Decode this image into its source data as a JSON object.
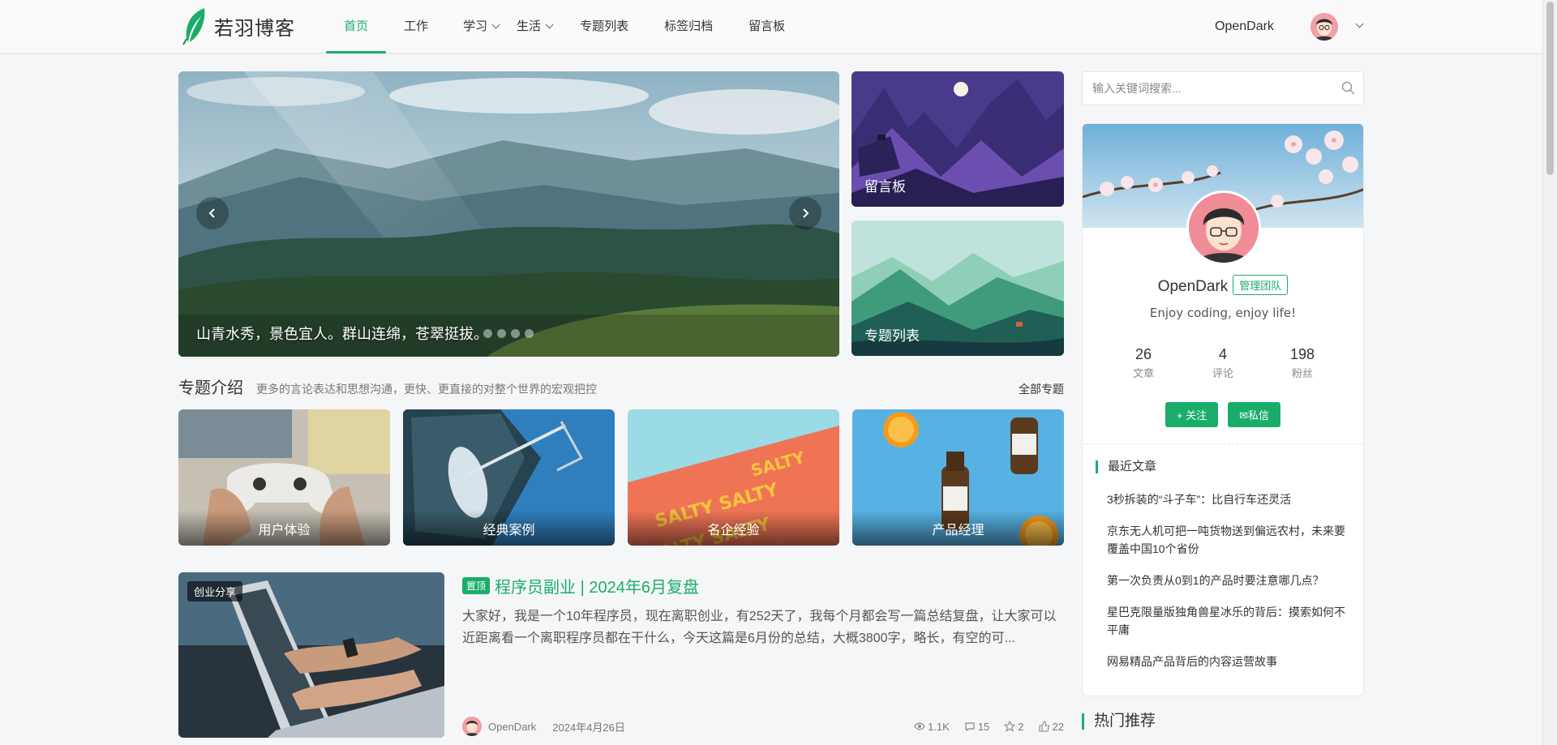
{
  "header": {
    "logo_text": "若羽博客",
    "nav": [
      {
        "label": "首页",
        "active": true,
        "has_dropdown": false
      },
      {
        "label": "工作",
        "active": false,
        "has_dropdown": false
      },
      {
        "label": "学习",
        "active": false,
        "has_dropdown": true
      },
      {
        "label": "生活",
        "active": false,
        "has_dropdown": true
      },
      {
        "label": "专题列表",
        "active": false,
        "has_dropdown": false
      },
      {
        "label": "标签归档",
        "active": false,
        "has_dropdown": false
      },
      {
        "label": "留言板",
        "active": false,
        "has_dropdown": false
      }
    ],
    "user_name": "OpenDark",
    "accent_color": "#1aad6a"
  },
  "hero": {
    "main_caption": "山青水秀，景色宜人。群山连绵，苍翠挺拔。",
    "dot_count": 4,
    "side_cards": [
      {
        "label": "留言板"
      },
      {
        "label": "专题列表"
      }
    ]
  },
  "topics": {
    "title": "专题介绍",
    "description": "更多的言论表达和思想沟通，更快、更直接的对整个世界的宏观把控",
    "all_link": "全部专题",
    "cards": [
      {
        "label": "用户体验"
      },
      {
        "label": "经典案例"
      },
      {
        "label": "名企经验"
      },
      {
        "label": "产品经理"
      }
    ]
  },
  "post": {
    "category_tag": "创业分享",
    "pin_label": "置顶",
    "title": "程序员副业 | 2024年6月复盘",
    "excerpt": "大家好，我是一个10年程序员，现在离职创业，有252天了，我每个月都会写一篇总结复盘，让大家可以近距离看一个离职程序员都在干什么，今天这篇是6月份的总结，大概3800字，略长，有空的可...",
    "author": "OpenDark",
    "date": "2024年4月26日",
    "views": "1.1K",
    "comments": "15",
    "stars": "2",
    "likes": "22"
  },
  "sidebar": {
    "search_placeholder": "输入关键词搜索...",
    "profile": {
      "name": "OpenDark",
      "badge": "管理团队",
      "bio": "Enjoy coding, enjoy life!",
      "stats": [
        {
          "num": "26",
          "label": "文章"
        },
        {
          "num": "4",
          "label": "评论"
        },
        {
          "num": "198",
          "label": "粉丝"
        }
      ],
      "follow_label": "+ 关注",
      "message_label": "✉私信"
    },
    "recent_title": "最近文章",
    "recent_posts": [
      "3秒拆装的“斗子车”：比自行车还灵活",
      "京东无人机可把一吨货物送到偏远农村，未来要覆盖中国10个省份",
      "第一次负责从0到1的产品时要注意哪几点？",
      "星巴克限量版独角兽星冰乐的背后：摸索如何不平庸",
      "网易精品产品背后的内容运营故事"
    ],
    "hot_title": "热门推荐"
  }
}
